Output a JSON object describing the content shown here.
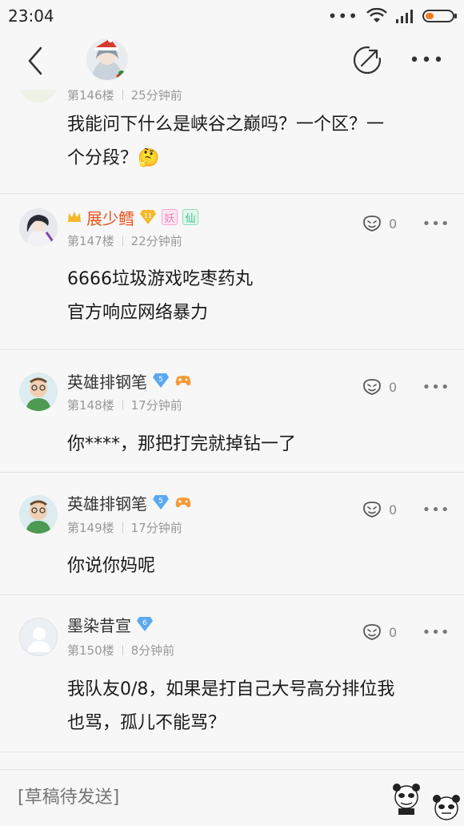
{
  "status_bar": {
    "time": "23:04",
    "menu_dots": "•••"
  },
  "nav": {
    "more_label": "•••"
  },
  "comments": [
    {
      "floor": "第146楼",
      "time": "25分钟前",
      "text_lines": [
        "我能问下什么是峡谷之巅吗？一个区？一",
        "个分段？🤔"
      ]
    },
    {
      "name": "展少鳕",
      "floor": "第147楼",
      "time": "22分钟前",
      "likes": "0",
      "text_lines": [
        "6666垃圾游戏吃枣药丸",
        "官方响应网络暴力"
      ],
      "level": "11",
      "tag1": "妖",
      "tag2": "仙"
    },
    {
      "name": "英雄排钢笔",
      "floor": "第148楼",
      "time": "17分钟前",
      "likes": "0",
      "text_lines": [
        "你****，那把打完就掉钻一了"
      ],
      "level": "5"
    },
    {
      "name": "英雄排钢笔",
      "floor": "第149楼",
      "time": "17分钟前",
      "likes": "0",
      "text_lines": [
        "你说你妈呢"
      ],
      "level": "5"
    },
    {
      "name": "墨染昔宣",
      "floor": "第150楼",
      "time": "8分钟前",
      "likes": "0",
      "text_lines": [
        "我队友0/8，如果是打自己大号高分排位我",
        "也骂，孤儿不能骂？"
      ],
      "level": "6"
    }
  ],
  "comment_more_label": "•••",
  "input_bar": {
    "placeholder": "[草稿待发送]"
  },
  "colors": {
    "vip_name": "#e8541e",
    "gem_blue": "#5aa9f0",
    "gem_gold": "#f5b92b",
    "tag_pink": "#f080b8",
    "tag_green": "#38c08a"
  },
  "icons": [
    "back-icon",
    "share-icon",
    "more-icon",
    "like-icon",
    "gem-badge-icon",
    "gamepad-icon",
    "crown-icon"
  ]
}
